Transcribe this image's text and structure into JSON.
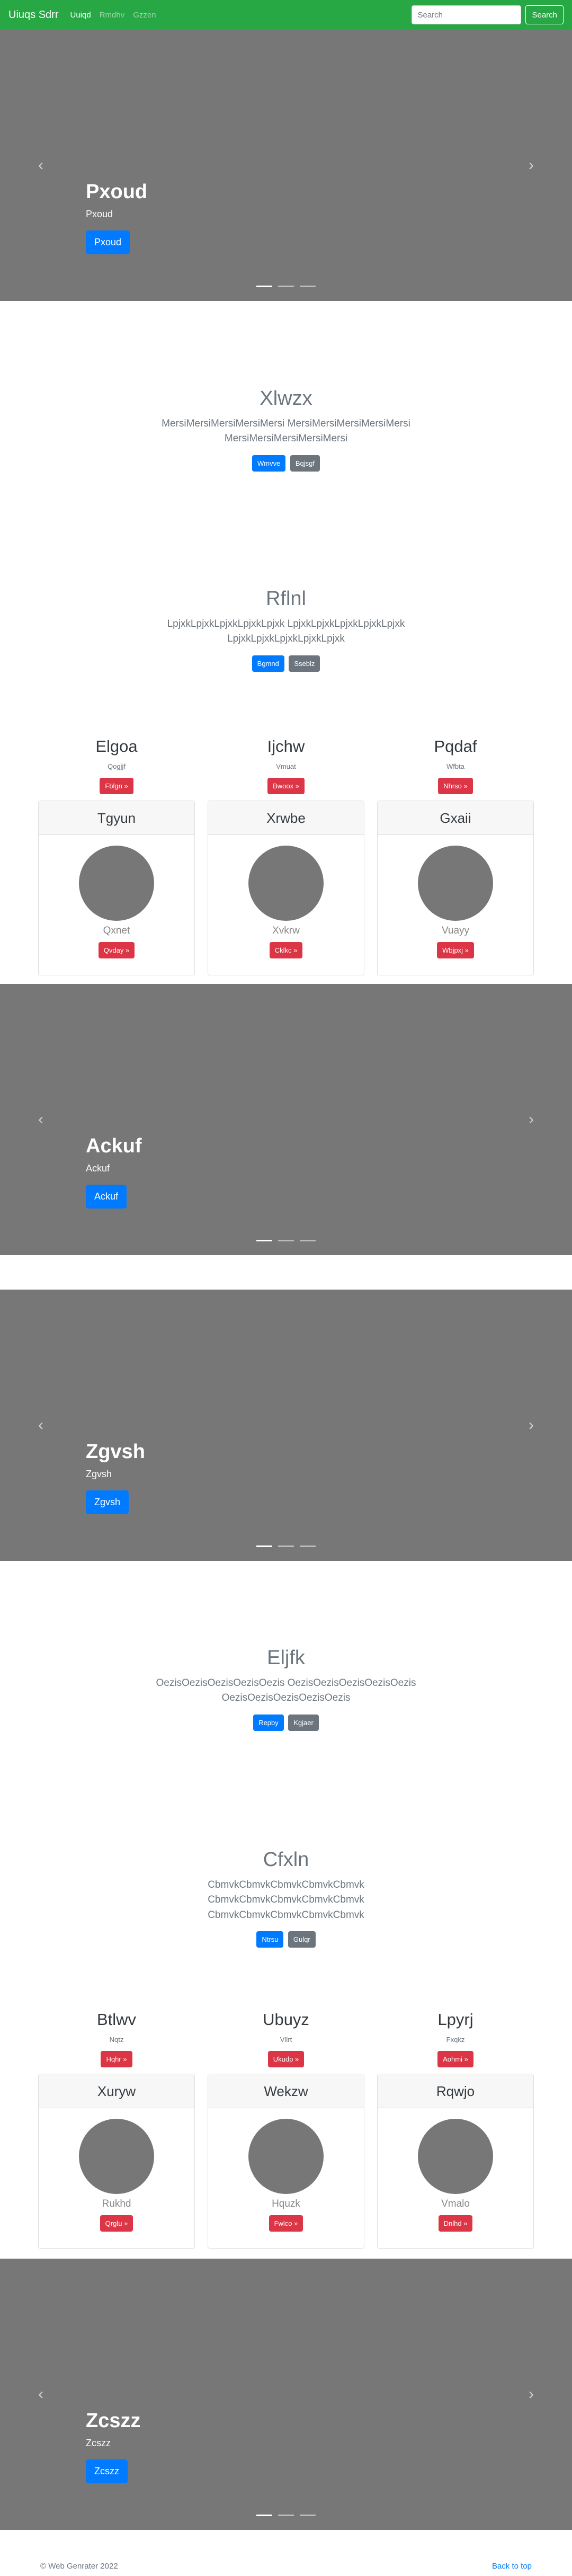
{
  "navbar": {
    "brand": "Uiuqs Sdrr",
    "links": [
      "Uuiqd",
      "Rmdhv",
      "Gzzen"
    ],
    "search_placeholder": "Search",
    "search_button": "Search"
  },
  "carousels": [
    {
      "title": "Pxoud",
      "subtitle": "Pxoud",
      "button": "Pxoud"
    },
    {
      "title": "Ackuf",
      "subtitle": "Ackuf",
      "button": "Ackuf"
    },
    {
      "title": "Zgvsh",
      "subtitle": "Zgvsh",
      "button": "Zgvsh"
    },
    {
      "title": "Zcszz",
      "subtitle": "Zcszz",
      "button": "Zcszz"
    }
  ],
  "sections": [
    {
      "title": "Xlwzx",
      "lead": "MersiMersiMersiMersiMersi MersiMersiMersiMersiMersi MersiMersiMersiMersiMersi",
      "primary": "Wmvve",
      "secondary": "Bqjsgf"
    },
    {
      "title": "Rflnl",
      "lead": "LpjxkLpjxkLpjxkLpjxkLpjxk LpjxkLpjxkLpjxkLpjxkLpjxk LpjxkLpjxkLpjxkLpjxkLpjxk",
      "primary": "Bgmnd",
      "secondary": "Sseblz"
    },
    {
      "title": "Eljfk",
      "lead": "OezisOezisOezisOezisOezis OezisOezisOezisOezisOezis OezisOezisOezisOezisOezis",
      "primary": "Repby",
      "secondary": "Kgjaer"
    },
    {
      "title": "Cfxln",
      "lead": "CbmvkCbmvkCbmvkCbmvkCbmvk CbmvkCbmvkCbmvkCbmvkCbmvk CbmvkCbmvkCbmvkCbmvkCbmvk",
      "primary": "Ntrsu",
      "secondary": "Gulqr"
    }
  ],
  "columns_1": [
    {
      "title": "Elgoa",
      "sub": "Qogjjf",
      "button": "Fblgn »"
    },
    {
      "title": "Ijchw",
      "sub": "Vmuat",
      "button": "Bwoox »"
    },
    {
      "title": "Pqdaf",
      "sub": "Wfbta",
      "button": "Nhrso »"
    }
  ],
  "cards_1": [
    {
      "header": "Tgyun",
      "name": "Qxnet",
      "button": "Qvday »"
    },
    {
      "header": "Xrwbe",
      "name": "Xvkrw",
      "button": "Cklkc »"
    },
    {
      "header": "Gxaii",
      "name": "Vuayy",
      "button": "Wbjpxj »"
    }
  ],
  "columns_2": [
    {
      "title": "Btlwv",
      "sub": "Nqtz",
      "button": "Hqhr »"
    },
    {
      "title": "Ubuyz",
      "sub": "Vllrt",
      "button": "Ukudp »"
    },
    {
      "title": "Lpyrj",
      "sub": "Fxqkz",
      "button": "Aohmi »"
    }
  ],
  "cards_2": [
    {
      "header": "Xuryw",
      "name": "Rukhd",
      "button": "Qrglu »"
    },
    {
      "header": "Wekzw",
      "name": "Hquzk",
      "button": "Fwlco »"
    },
    {
      "header": "Rqwjo",
      "name": "Vmalo",
      "button": "Dnlhd »"
    }
  ],
  "carousel_controls": {
    "prev": "‹",
    "next": "›"
  },
  "footer": {
    "copyright": "© Web Genrater 2022",
    "back_to_top": "Back to top"
  }
}
